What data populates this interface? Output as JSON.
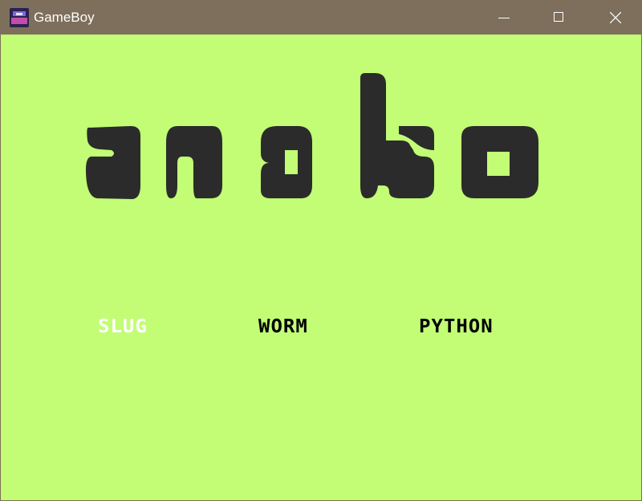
{
  "window": {
    "title": "GameBoy",
    "icon": "gameboy-app-icon",
    "controls": {
      "minimize": "minimize-icon",
      "maximize": "maximize-icon",
      "close": "close-icon"
    }
  },
  "game": {
    "logo_text": "snake",
    "menu": [
      {
        "label": "SLUG",
        "selected": true
      },
      {
        "label": "WORM",
        "selected": false
      },
      {
        "label": "PYTHON",
        "selected": false
      }
    ]
  },
  "colors": {
    "background": "#c2fd75",
    "titlebar": "#7d6f5b",
    "logo": "#2b2b2b",
    "selected": "#ffffff",
    "unselected": "#000000"
  }
}
